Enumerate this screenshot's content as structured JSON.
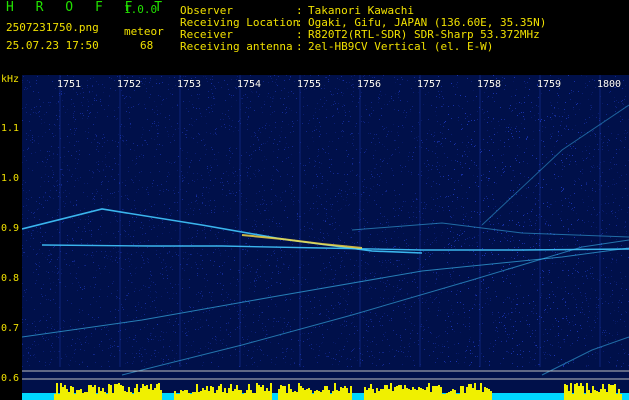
{
  "header": {
    "app_title": "H R O F F T",
    "version": "1.0.0",
    "filename": "2507231750.png",
    "timestamp": "25.07.23 17:50",
    "meteor_label": "meteor",
    "meteor_count": "68"
  },
  "info": {
    "rows": [
      {
        "label": "Observer",
        "sep": ":",
        "value": "Takanori Kawachi"
      },
      {
        "label": "Receiving Location",
        "sep": ":",
        "value": "Ogaki, Gifu, JAPAN (136.60E, 35.35N)"
      },
      {
        "label": "Receiver",
        "sep": ":",
        "value": "R820T2(RTL-SDR) SDR-Sharp 53.372MHz"
      },
      {
        "label": "Receiving antenna",
        "sep": ":",
        "value": "2el-HB9CV Vertical (el. E-W)"
      }
    ]
  },
  "axis": {
    "unit_label": "kHz",
    "y_ticks": [
      "1.1",
      "1.0",
      "0.9",
      "0.8",
      "0.7",
      "0.6"
    ],
    "x_ticks": [
      "1751",
      "1752",
      "1753",
      "1754",
      "1755",
      "1756",
      "1757",
      "1758",
      "1759",
      "1800"
    ]
  },
  "colors": {
    "background": "#00104a",
    "noise": "#1f3cc8",
    "trace": "#40c8ff",
    "hot": "#ffe040",
    "header_green": "#22e000",
    "header_yellow": "#f0e000",
    "bar_yellow": "#f0f000",
    "bar_cyan": "#00d8ff"
  }
}
